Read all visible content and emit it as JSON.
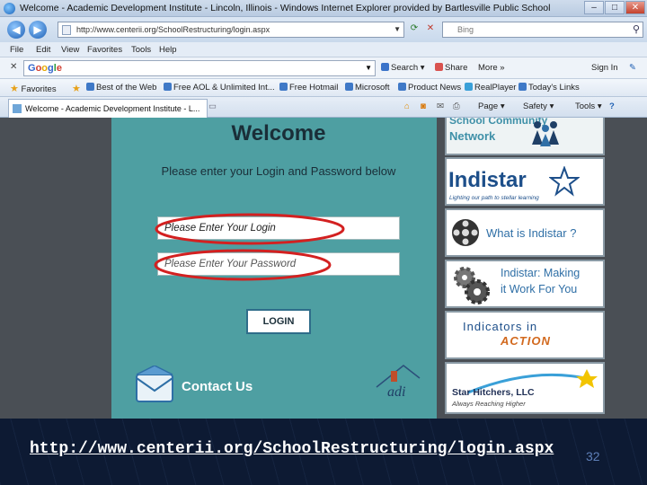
{
  "window": {
    "title": "Welcome - Academic Development Institute - Lincoln, Illinois - Windows Internet Explorer provided by Bartlesville Public School",
    "buttons": [
      "–",
      "□",
      "✕"
    ]
  },
  "address": {
    "url": "http://www.centerii.org/SchoolRestructuring/login.aspx",
    "search_placeholder": "Bing"
  },
  "menu": [
    "File",
    "Edit",
    "View",
    "Favorites",
    "Tools",
    "Help"
  ],
  "google_toolbar": {
    "logo": "Google",
    "search_label": "Search",
    "share_label": "Share",
    "more_label": "More »",
    "signin_label": "Sign In"
  },
  "favorites_bar": {
    "favorites_label": "Favorites",
    "items": [
      "Best of the Web",
      "Free AOL & Unlimited Int...",
      "Free Hotmail",
      "Microsoft",
      "Product News",
      "RealPlayer",
      "Today's Links"
    ]
  },
  "tabs": {
    "active_label": "Welcome - Academic Development Institute - L...",
    "page_label": "Page ▾",
    "safety_label": "Safety ▾",
    "tools_label": "Tools ▾"
  },
  "page": {
    "heading": "Welcome",
    "instructions": "Please enter your Login and Password below",
    "login_placeholder": "Please Enter Your Login",
    "password_placeholder": "Please Enter Your Password",
    "login_button": "LOGIN",
    "contact_label": "Contact Us",
    "adi_logo_text": "adi"
  },
  "sidebar": {
    "card1": {
      "line1": "School Community",
      "line2": "Network"
    },
    "card2": {
      "brand": "Indistar",
      "tagline": "Lighting our path to stellar learning"
    },
    "card3": {
      "label": "What is Indistar ?"
    },
    "card4": {
      "line1": "Indistar: Making",
      "line2": "it Work For You"
    },
    "card5": {
      "line1": "Indicators in",
      "line2": "ACTION"
    },
    "card6": {
      "line1": "Star Hitchers, LLC",
      "line2": "Always Reaching Higher"
    }
  },
  "colors": {
    "panel_teal": "#4e9fa2",
    "annotation_red": "#d32020",
    "caption_bg": "#0d1a33"
  },
  "caption": {
    "url_text": "http://www.centerii.org/SchoolRestructuring/login.aspx",
    "slide_number": "32"
  }
}
